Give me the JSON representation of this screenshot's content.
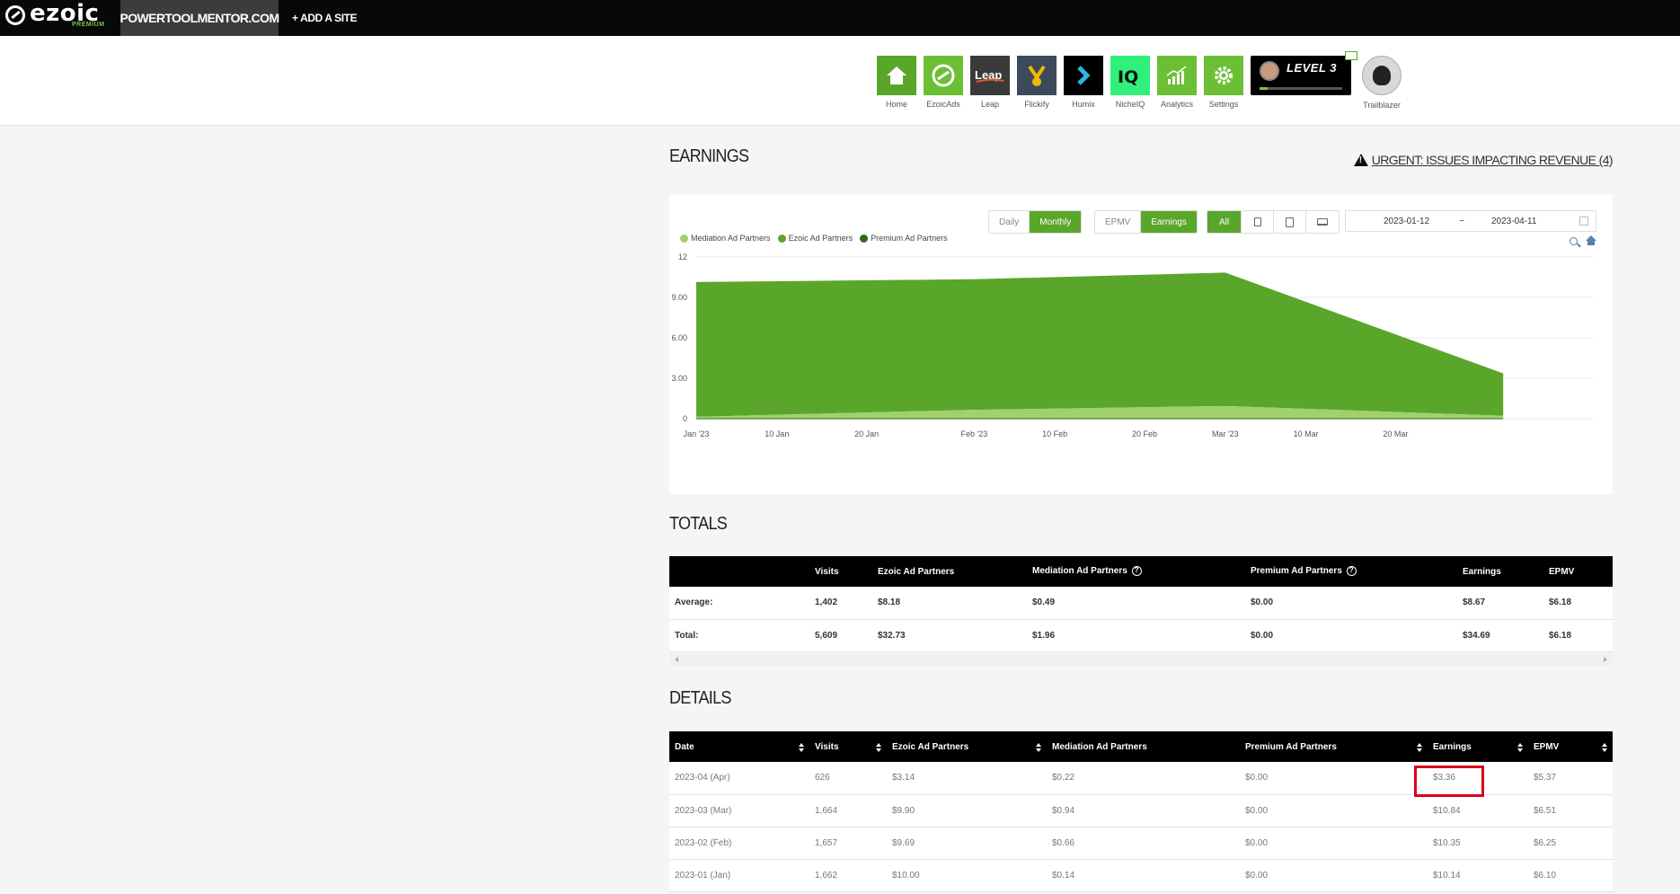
{
  "nav": {
    "brand": "ezoic",
    "brand_sub": "PREMIUM",
    "site_name": "POWERTOOLMENTOR.COM",
    "add_site": "+ ADD A SITE"
  },
  "apps": [
    {
      "label": "Home",
      "icon": "home-icon",
      "bg": "#5aa62a"
    },
    {
      "label": "EzoicAds",
      "icon": "ezoicads-icon",
      "bg": "#6cbf35"
    },
    {
      "label": "Leap",
      "icon": "leap-icon",
      "bg": "#3a3a3a"
    },
    {
      "label": "Flickify",
      "icon": "flickify-icon",
      "bg": "#3c4b5a"
    },
    {
      "label": "Humix",
      "icon": "humix-icon",
      "bg": "#000000"
    },
    {
      "label": "NicheIQ",
      "icon": "nicheiq-icon",
      "bg": "#2ff07a"
    },
    {
      "label": "Analytics",
      "icon": "analytics-icon",
      "bg": "#6cbf35"
    },
    {
      "label": "Settings",
      "icon": "settings-icon",
      "bg": "#6cbf35"
    }
  ],
  "level": {
    "label": "LEVEL 3",
    "progress": 0.1
  },
  "trailblazer": "Trailblazer",
  "earnings_title": "EARNINGS",
  "urgent": "URGENT: ISSUES IMPACTING REVENUE (4)",
  "controls": {
    "daily": "Daily",
    "monthly": "Monthly",
    "epmv": "EPMV",
    "earnings": "Earnings",
    "all": "All",
    "date_start": "2023-01-12",
    "date_sep": "~",
    "date_end": "2023-04-11"
  },
  "legend": [
    {
      "name": "Mediation Ad Partners",
      "color": "#9fd16f"
    },
    {
      "name": "Ezoic Ad Partners",
      "color": "#5aa62a"
    },
    {
      "name": "Premium Ad Partners",
      "color": "#2e6b14"
    }
  ],
  "chart_data": {
    "type": "area",
    "x_ticks": [
      "Jan '23",
      "10 Jan",
      "20 Jan",
      "Feb '23",
      "10 Feb",
      "20 Feb",
      "Mar '23",
      "10 Mar",
      "20 Mar"
    ],
    "y_ticks": [
      "0",
      "3.00",
      "6.00",
      "9.00",
      "12"
    ],
    "ylim": [
      0,
      12
    ],
    "x": [
      "2023-01-01",
      "2023-02-01",
      "2023-03-01",
      "2023-04-01"
    ],
    "series": [
      {
        "name": "Mediation Ad Partners",
        "values": [
          0.14,
          0.66,
          0.94,
          0.22
        ]
      },
      {
        "name": "Ezoic Ad Partners",
        "values": [
          10.0,
          9.69,
          9.9,
          3.14
        ]
      },
      {
        "name": "Premium Ad Partners",
        "values": [
          0,
          0,
          0,
          0
        ]
      }
    ]
  },
  "totals_title": "TOTALS",
  "totals": {
    "headers": [
      "",
      "Visits",
      "Ezoic Ad Partners",
      "Mediation Ad Partners",
      "Premium Ad Partners",
      "Earnings",
      "EPMV"
    ],
    "rows": [
      [
        "Average:",
        "1,402",
        "$8.18",
        "$0.49",
        "$0.00",
        "$8.67",
        "$6.18"
      ],
      [
        "Total:",
        "5,609",
        "$32.73",
        "$1.96",
        "$0.00",
        "$34.69",
        "$6.18"
      ]
    ]
  },
  "details_title": "DETAILS",
  "details": {
    "headers": [
      "Date",
      "Visits",
      "Ezoic Ad Partners",
      "Mediation Ad Partners",
      "Premium Ad Partners",
      "Earnings",
      "EPMV"
    ],
    "rows": [
      [
        "2023-04 (Apr)",
        "626",
        "$3.14",
        "$0.22",
        "$0.00",
        "$3.36",
        "$5.37"
      ],
      [
        "2023-03 (Mar)",
        "1,664",
        "$9.90",
        "$0.94",
        "$0.00",
        "$10.84",
        "$6.51"
      ],
      [
        "2023-02 (Feb)",
        "1,657",
        "$9.69",
        "$0.66",
        "$0.00",
        "$10.35",
        "$6.25"
      ],
      [
        "2023-01 (Jan)",
        "1,662",
        "$10.00",
        "$0.14",
        "$0.00",
        "$10.14",
        "$6.10"
      ]
    ]
  }
}
